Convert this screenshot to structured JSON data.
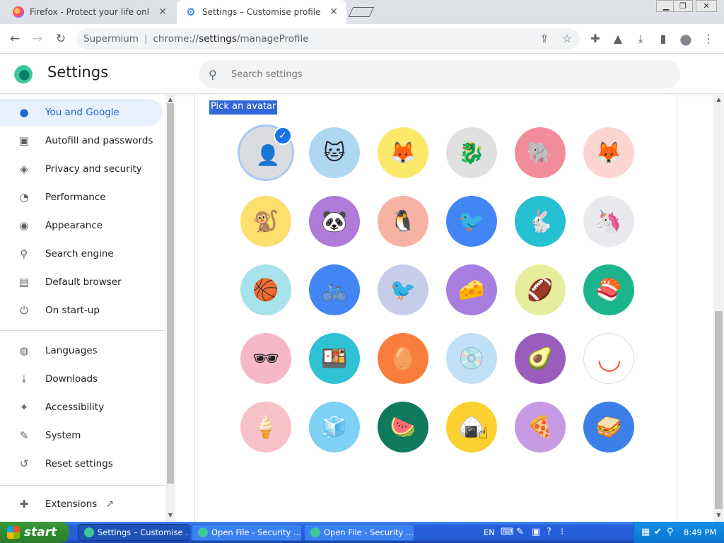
{
  "tabs": [
    {
      "title": "Firefox - Protect your life online with",
      "close": "✕"
    },
    {
      "title": "Settings – Customise profile",
      "close": "✕"
    }
  ],
  "window_controls": {
    "minimize": "▁",
    "restore": "❐",
    "close": "✕"
  },
  "toolbar": {
    "back": "←",
    "forward": "→",
    "reload": "↻",
    "browser_name": "Supermium",
    "url_scheme": "chrome://",
    "url_host": "settings",
    "url_path": "/manageProfile",
    "share": "⇪",
    "bookmark": "☆",
    "extensions": "✚",
    "labs": "▲",
    "download": "⤓",
    "sidepanel": "▮",
    "profile": "●",
    "menu": "⋮"
  },
  "header": {
    "title": "Settings",
    "search_placeholder": "Search settings",
    "search_icon": "⚲"
  },
  "sidebar": {
    "items": [
      {
        "label": "You and Google",
        "icon": "👤",
        "icon_name": "person-icon",
        "selected": true
      },
      {
        "label": "Autofill and passwords",
        "icon": "📋",
        "icon_name": "clipboard-icon"
      },
      {
        "label": "Privacy and security",
        "icon": "⛨",
        "icon_name": "shield-icon"
      },
      {
        "label": "Performance",
        "icon": "◔",
        "icon_name": "speedometer-icon"
      },
      {
        "label": "Appearance",
        "icon": "🎨",
        "icon_name": "palette-icon"
      },
      {
        "label": "Search engine",
        "icon": "⚲",
        "icon_name": "search-icon"
      },
      {
        "label": "Default browser",
        "icon": "▤",
        "icon_name": "browser-window-icon"
      },
      {
        "label": "On start-up",
        "icon": "⏻",
        "icon_name": "power-icon"
      }
    ],
    "items2": [
      {
        "label": "Languages",
        "icon": "🌐",
        "icon_name": "globe-icon"
      },
      {
        "label": "Downloads",
        "icon": "⤓",
        "icon_name": "download-icon"
      },
      {
        "label": "Accessibility",
        "icon": "♿",
        "icon_name": "accessibility-icon"
      },
      {
        "label": "System",
        "icon": "🔧",
        "icon_name": "wrench-icon"
      },
      {
        "label": "Reset settings",
        "icon": "↺",
        "icon_name": "history-icon"
      }
    ],
    "extensions": {
      "label": "Extensions",
      "icon": "✚",
      "link_icon": "↗"
    }
  },
  "main": {
    "section_label": "Pick an avatar",
    "avatars": [
      {
        "name": "default-person",
        "bg": "#dadce0",
        "glyph": "👤",
        "selected": true
      },
      {
        "name": "origami-cat",
        "bg": "#aed7f2",
        "glyph": "🐱"
      },
      {
        "name": "origami-fox",
        "bg": "#fce96a",
        "glyph": "🦊"
      },
      {
        "name": "origami-dragon",
        "bg": "#e0e0e0",
        "glyph": "🐉"
      },
      {
        "name": "origami-elephant",
        "bg": "#f28b9a",
        "glyph": "🐘"
      },
      {
        "name": "origami-fox-red",
        "bg": "#fcd5d0",
        "glyph": "🦊"
      },
      {
        "name": "origami-monkey",
        "bg": "#fcdf6c",
        "glyph": "🐒"
      },
      {
        "name": "origami-panda",
        "bg": "#b07ad9",
        "glyph": "🐼"
      },
      {
        "name": "origami-penguin",
        "bg": "#f6b3a4",
        "glyph": "🐧"
      },
      {
        "name": "origami-bird",
        "bg": "#4285f4",
        "glyph": "🐦"
      },
      {
        "name": "origami-rabbit",
        "bg": "#26c0d3",
        "glyph": "🐇"
      },
      {
        "name": "origami-unicorn",
        "bg": "#e8eaed",
        "glyph": "🦄"
      },
      {
        "name": "basketball",
        "bg": "#a7e3ea",
        "glyph": "🏀"
      },
      {
        "name": "bike",
        "bg": "#4285f4",
        "glyph": "🚲"
      },
      {
        "name": "red-bird",
        "bg": "#c7cde8",
        "glyph": "🐦"
      },
      {
        "name": "cheese",
        "bg": "#a67ee0",
        "glyph": "🧀"
      },
      {
        "name": "football",
        "bg": "#e6ed9c",
        "glyph": "🏈"
      },
      {
        "name": "sushi-plate",
        "bg": "#1cb58b",
        "glyph": "🍣"
      },
      {
        "name": "sunglasses",
        "bg": "#f6b8c8",
        "glyph": "🕶"
      },
      {
        "name": "sushi",
        "bg": "#2fc2d4",
        "glyph": "🍱"
      },
      {
        "name": "tamagotchi",
        "bg": "#f97d3c",
        "glyph": "🥚"
      },
      {
        "name": "vinyl",
        "bg": "#bfe0f7",
        "glyph": "💿"
      },
      {
        "name": "avocado",
        "bg": "#9b5dbd",
        "glyph": "🥑"
      },
      {
        "name": "smiley",
        "bg": "#ffffff",
        "glyph": "◡"
      },
      {
        "name": "ice-cream",
        "bg": "#f6c1c7",
        "glyph": "🍦"
      },
      {
        "name": "ice-cubes",
        "bg": "#7fd0f5",
        "glyph": "🧊"
      },
      {
        "name": "watermelon",
        "bg": "#0f7a5c",
        "glyph": "🍉"
      },
      {
        "name": "onigiri",
        "bg": "#fcd02e",
        "glyph": "🍙"
      },
      {
        "name": "pizza",
        "bg": "#c79be4",
        "glyph": "🍕"
      },
      {
        "name": "sandwich",
        "bg": "#3a80e8",
        "glyph": "🥪"
      }
    ],
    "selected_check": "✓"
  },
  "taskbar": {
    "start_label": "start",
    "tasks": [
      {
        "label": "Settings – Customise ..."
      },
      {
        "label": "Open File - Security ..."
      },
      {
        "label": "Open File - Security ..."
      }
    ],
    "language": "EN",
    "clock": "8:49 PM"
  }
}
